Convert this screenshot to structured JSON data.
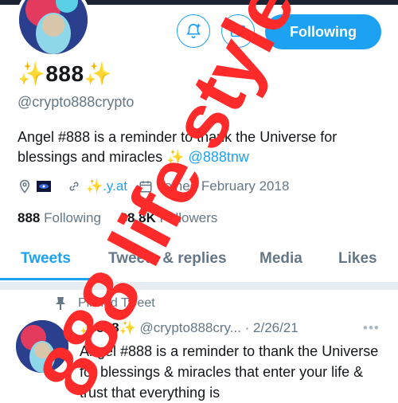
{
  "profile": {
    "name": "✨888✨",
    "handle": "@crypto888crypto",
    "bio_text": "Angel #888 is a reminder to thank the Universe for blessings and miracles",
    "bio_emoji": "✨",
    "bio_link": "@888tnw",
    "website": "✨.y.at",
    "joined": "Joined February 2018",
    "following_count": "888",
    "following_label": "Following",
    "followers_count": "88.8K",
    "followers_label": "Followers"
  },
  "actions": {
    "follow_label": "Following"
  },
  "tabs": [
    {
      "label": "Tweets"
    },
    {
      "label": "Tweets & replies"
    },
    {
      "label": "Media"
    },
    {
      "label": "Likes"
    }
  ],
  "pinned": {
    "label": "Pinned Tweet"
  },
  "tweet": {
    "name": "✨888✨",
    "handle": "@crypto888cry...",
    "date": "· 2/26/21",
    "more": "•••",
    "text": "Angel #888 is a reminder to thank the Universe for blessings & miracles that enter your life & trust that everything is"
  },
  "watermark": {
    "text": "888 life style",
    "color": "#ff2a2a"
  },
  "colors": {
    "accent": "#1da1f2",
    "muted": "#657786"
  }
}
